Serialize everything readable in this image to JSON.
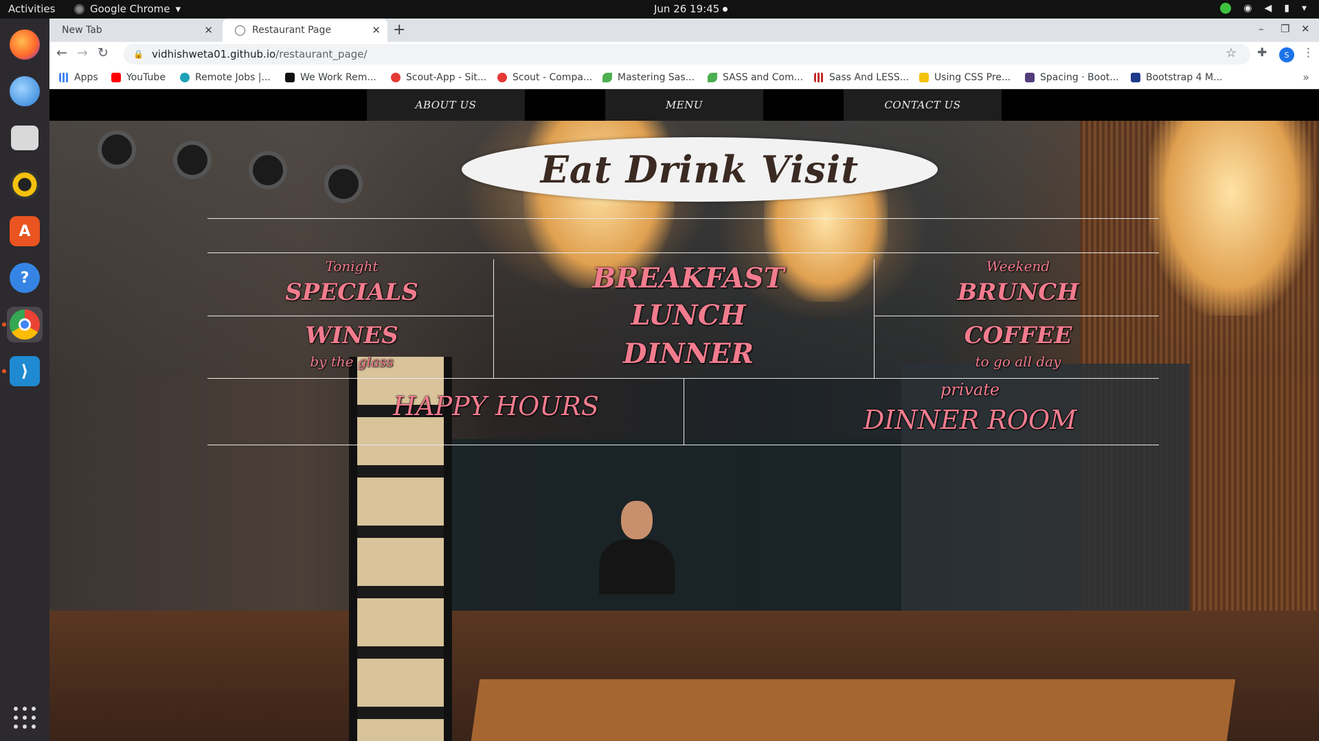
{
  "system": {
    "activities": "Activities",
    "app_name": "Google Chrome",
    "clock": "Jun 26  19:45"
  },
  "browser": {
    "tabs": [
      {
        "label": "New Tab"
      },
      {
        "label": "Restaurant Page"
      }
    ],
    "url": {
      "host": "vidhishweta01.github.io",
      "path": "/restaurant_page/"
    },
    "profile_initial": "S",
    "bookmarks": [
      {
        "label": "Apps",
        "color": "#4285f4"
      },
      {
        "label": "YouTube",
        "color": "#ff0000"
      },
      {
        "label": "Remote Jobs |...",
        "color": "#1fa2b8"
      },
      {
        "label": "We Work Rem...",
        "color": "#111111"
      },
      {
        "label": "Scout-App - Sit...",
        "color": "#e53935"
      },
      {
        "label": "Scout - Compa...",
        "color": "#e53935"
      },
      {
        "label": "Mastering Sas...",
        "color": "#4caf50"
      },
      {
        "label": "SASS and Com...",
        "color": "#4caf50"
      },
      {
        "label": "Sass And LESS...",
        "color": "#c62828"
      },
      {
        "label": "Using CSS Pre...",
        "color": "#f4c20d"
      },
      {
        "label": "Spacing · Boot...",
        "color": "#563d7c"
      },
      {
        "label": "Bootstrap 4 M...",
        "color": "#1e3a8a"
      }
    ]
  },
  "site": {
    "nav": {
      "about": "ABOUT US",
      "menu": "MENU",
      "contact": "CONTACT US"
    },
    "logo": "Eat Drink Visit",
    "specials": {
      "small": "Tonight",
      "big": "SPECIALS"
    },
    "wines": {
      "big": "WINES",
      "small": "by the glass"
    },
    "meals": [
      "BREAKFAST",
      "LUNCH",
      "DINNER"
    ],
    "brunch": {
      "small": "Weekend",
      "big": "BRUNCH"
    },
    "coffee": {
      "big": "COFFEE",
      "small": "to go all day"
    },
    "happy_hours": "HAPPY HOURS",
    "dinner_room": {
      "small": "private",
      "big": "DINNER ROOM"
    },
    "accent_color": "#f27c8e"
  }
}
